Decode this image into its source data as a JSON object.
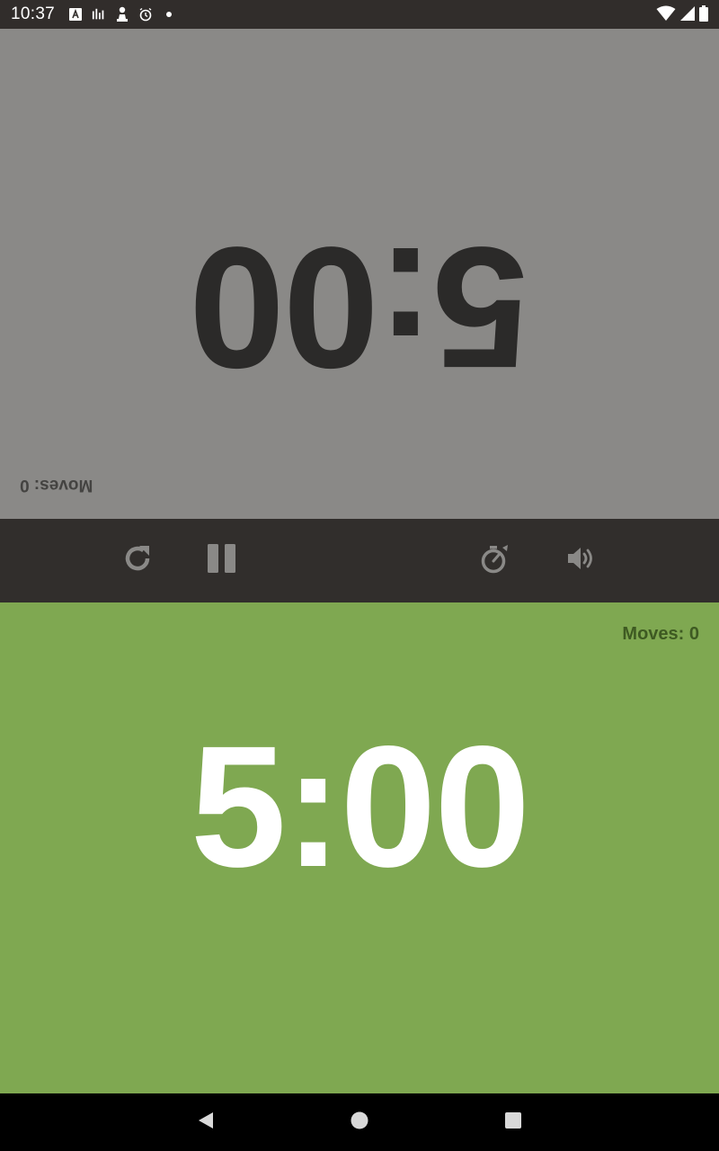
{
  "status_bar": {
    "time": "10:37",
    "left_icons": [
      "font-a-icon",
      "tune-bars-icon",
      "chess-pawn-icon",
      "alarm-icon",
      "dot-icon"
    ],
    "right_icons": [
      "wifi-icon",
      "cellular-signal-icon",
      "battery-icon"
    ]
  },
  "top_player": {
    "clock": "5:00",
    "moves": "Moves: 0",
    "color": "#8a8987"
  },
  "toolbar": {
    "buttons": [
      "reset-icon",
      "pause-icon",
      "timer-settings-icon",
      "sound-icon"
    ]
  },
  "bottom_player": {
    "clock": "5:00",
    "moves": "Moves: 0",
    "color": "#7fa851"
  },
  "nav_bar": {
    "buttons": [
      "back-icon",
      "home-icon",
      "recents-icon"
    ]
  }
}
